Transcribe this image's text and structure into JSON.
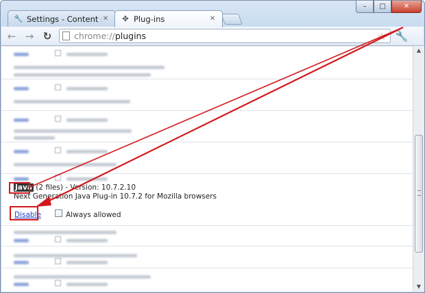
{
  "window": {
    "tabs": [
      {
        "title": "Settings - Content settings",
        "icon": "wrench-icon",
        "active": false
      },
      {
        "title": "Plug-ins",
        "icon": "puzzle-icon",
        "active": true
      }
    ],
    "controls": {
      "minimize": "–",
      "maximize": "□",
      "close": "✕"
    }
  },
  "toolbar": {
    "url_scheme": "chrome://",
    "url_host": "plugins"
  },
  "plugin": {
    "name": "Java",
    "details": " (2 files) - Version: 10.7.2.10",
    "description": "Next Generation Java Plug-in 10.7.2 for Mozilla browsers",
    "disable_label": "Disable",
    "always_allowed_label": "Always allowed"
  },
  "colors": {
    "highlight": "#d2181c",
    "link": "#1a3fc7"
  }
}
